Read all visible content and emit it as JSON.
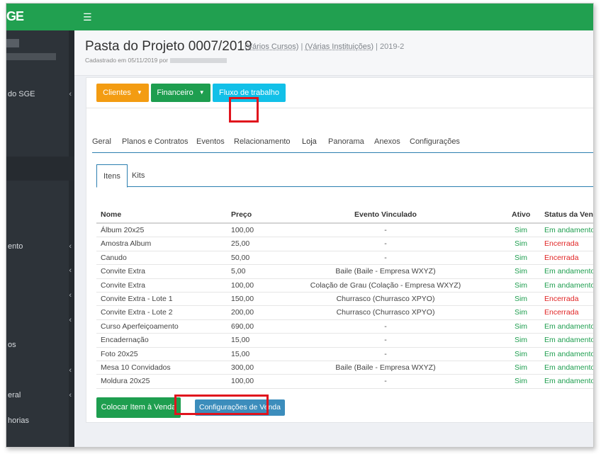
{
  "topbar": {
    "logo": "GE",
    "menu_icon": "hamburger-icon"
  },
  "sidebar": {
    "items": [
      {
        "label": "do SGE",
        "top": 0
      },
      {
        "label": "ento",
        "top": 0
      },
      {
        "label": "os",
        "top": 0
      },
      {
        "label": "eral",
        "top": 0
      },
      {
        "label": "horias",
        "top": 0
      }
    ]
  },
  "header": {
    "title": "Pasta do Projeto 0007/2019",
    "meta_cursos": "(Vários Cursos)",
    "meta_instituicoes": "(Várias Instituições)",
    "meta_year": "2019-2",
    "sep": "|",
    "created_label": "Cadastrado em 05/11/2019 por"
  },
  "toolbar": {
    "clientes": "Clientes",
    "financeiro": "Financeiro",
    "fluxo": "Fluxo de trabalho"
  },
  "tabs": [
    "Geral",
    "Planos e Contratos",
    "Eventos",
    "Relacionamento",
    "Loja",
    "Panorama",
    "Anexos",
    "Configurações"
  ],
  "active_tab": "Loja",
  "subtabs": [
    "Itens",
    "Kits"
  ],
  "table": {
    "headers": {
      "name": "Nome",
      "price": "Preço",
      "event": "Evento Vinculado",
      "active": "Ativo",
      "status": "Status da Venda"
    },
    "rows": [
      {
        "name": "Álbum 20x25",
        "price": "100,00",
        "event": "-",
        "active": "Sim",
        "status": "Em andamento"
      },
      {
        "name": "Amostra Album",
        "price": "25,00",
        "event": "-",
        "active": "Sim",
        "status": "Encerrada"
      },
      {
        "name": "Canudo",
        "price": "50,00",
        "event": "-",
        "active": "Sim",
        "status": "Encerrada"
      },
      {
        "name": "Convite Extra",
        "price": "5,00",
        "event": "Baile (Baile - Empresa WXYZ)",
        "active": "Sim",
        "status": "Em andamento"
      },
      {
        "name": "Convite Extra",
        "price": "100,00",
        "event": "Colação de Grau (Colação - Empresa WXYZ)",
        "active": "Sim",
        "status": "Em andamento"
      },
      {
        "name": "Convite Extra - Lote 1",
        "price": "150,00",
        "event": "Churrasco (Churrasco XPYO)",
        "active": "Sim",
        "status": "Encerrada"
      },
      {
        "name": "Convite Extra - Lote 2",
        "price": "200,00",
        "event": "Churrasco (Churrasco XPYO)",
        "active": "Sim",
        "status": "Encerrada"
      },
      {
        "name": "Curso Aperfeiçoamento",
        "price": "690,00",
        "event": "-",
        "active": "Sim",
        "status": "Em andamento"
      },
      {
        "name": "Encadernação",
        "price": "15,00",
        "event": "-",
        "active": "Sim",
        "status": "Em andamento"
      },
      {
        "name": "Foto 20x25",
        "price": "15,00",
        "event": "-",
        "active": "Sim",
        "status": "Em andamento"
      },
      {
        "name": "Mesa 10 Convidados",
        "price": "300,00",
        "event": "Baile (Baile - Empresa WXYZ)",
        "active": "Sim",
        "status": "Em andamento"
      },
      {
        "name": "Moldura 20x25",
        "price": "100,00",
        "event": "-",
        "active": "Sim",
        "status": "Em andamento"
      }
    ]
  },
  "actions": {
    "add": "Colocar Item à Venda",
    "config": "Configurações de Venda"
  },
  "colors": {
    "brand_green": "#21a050",
    "status_green": "#1e9e4f",
    "status_red": "#e02424",
    "highlight_red": "#e0141d",
    "sidebar_bg": "#2d3339",
    "tab_blue": "#2c7fb0"
  }
}
